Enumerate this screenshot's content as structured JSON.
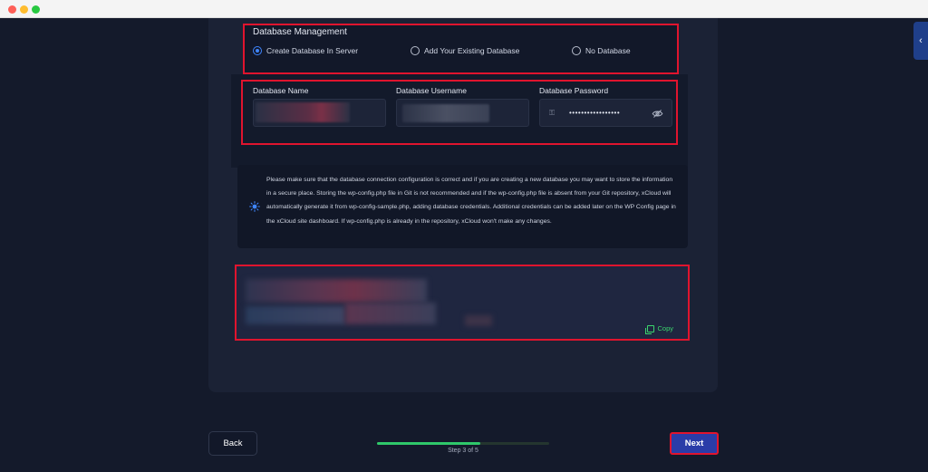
{
  "db_management": {
    "title": "Database Management",
    "options": [
      {
        "label": "Create Database In Server",
        "selected": true
      },
      {
        "label": "Add Your Existing Database",
        "selected": false
      },
      {
        "label": "No Database",
        "selected": false
      }
    ]
  },
  "fields": {
    "name_label": "Database Name",
    "username_label": "Database Username",
    "password_label": "Database Password",
    "password_value": "•••••••••••••••••"
  },
  "info": {
    "icon": "bulb-icon",
    "text": "Please make sure that the database connection configuration is correct and if you are creating a new database you may want to store the information in a secure place. Storing the wp-config.php file in Git is not recommended and if the wp-config.php file is absent from your Git repository, xCloud will automatically generate it from wp-config-sample.php, adding database credentials. Additional credentials can be added later on the WP Config page in the xCloud site dashboard. If wp-config.php is already in the repository, xCloud won't make any changes."
  },
  "code": {
    "copy_label": "Copy"
  },
  "footer": {
    "back_label": "Back",
    "next_label": "Next",
    "step_label": "Step 3 of 5",
    "progress": 0.6
  },
  "colors": {
    "accent": "#3f86ff",
    "success": "#2fc86a",
    "highlight": "#e0142e",
    "next_button": "#2a3ca8"
  }
}
